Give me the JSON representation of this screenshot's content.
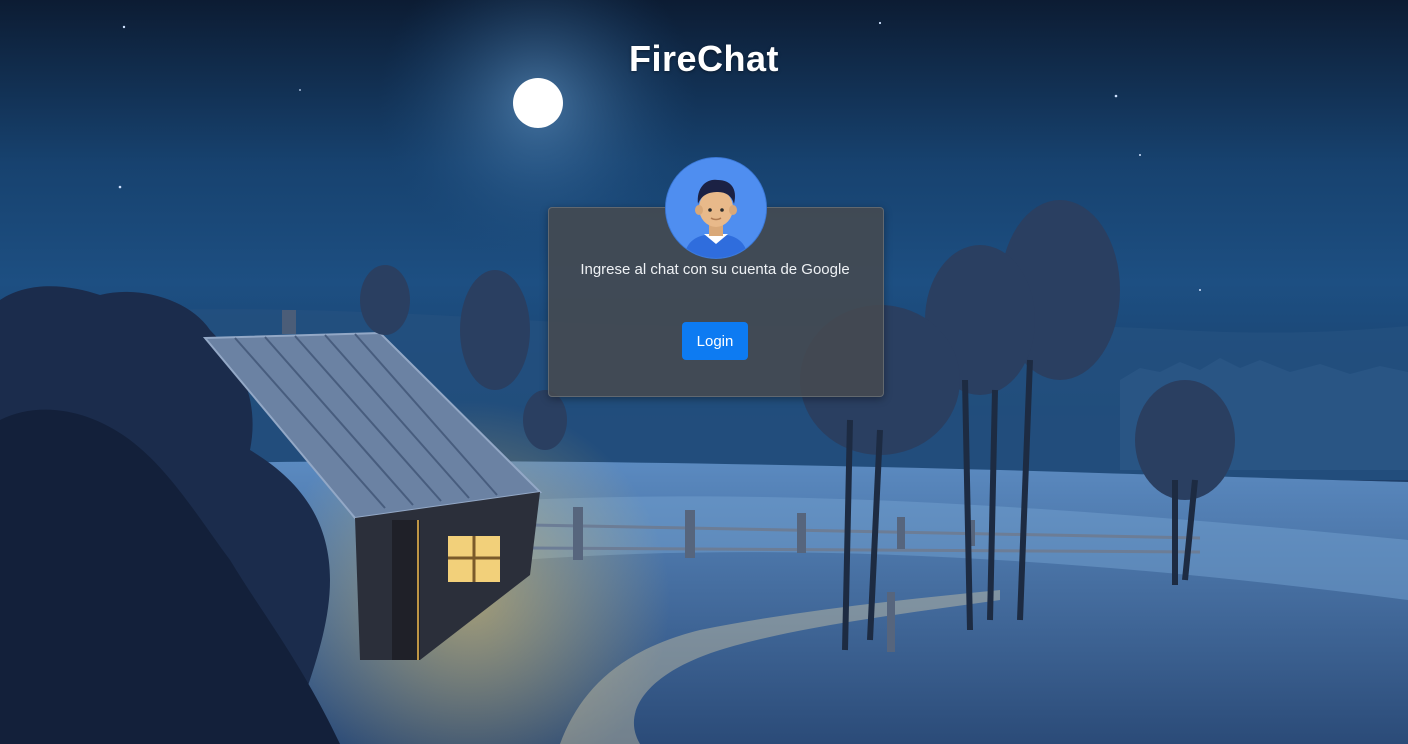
{
  "app": {
    "title": "FireChat"
  },
  "login_card": {
    "message": "Ingrese al chat con su cuenta de Google",
    "login_label": "Login",
    "avatar_icon": "user-avatar-icon"
  },
  "colors": {
    "button": "#0d7bf2",
    "card_background": "#464a50",
    "avatar_background": "#4f8ef0"
  }
}
